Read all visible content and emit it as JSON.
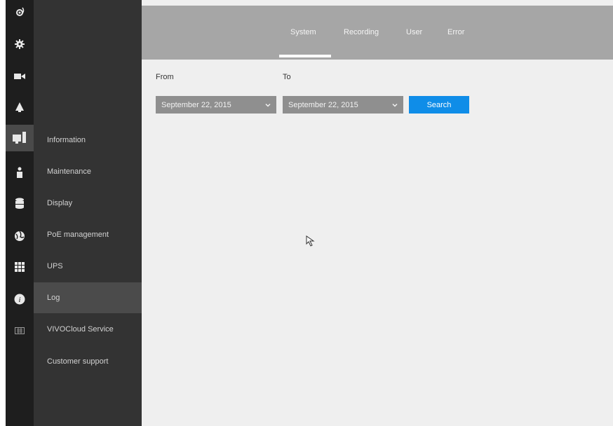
{
  "tabs": [
    {
      "label": "System"
    },
    {
      "label": "Recording"
    },
    {
      "label": "User"
    },
    {
      "label": "Error"
    }
  ],
  "active_tab": "System",
  "rail_icons": [
    "power-icon",
    "gear-icon",
    "camera-icon",
    "alarm-icon",
    "monitor-icon",
    "person-icon",
    "storage-icon",
    "network-icon",
    "grid-icon",
    "info-icon",
    "keyboard-icon"
  ],
  "active_rail_icon": "monitor-icon",
  "submenu": {
    "items": [
      {
        "label": "Information"
      },
      {
        "label": "Maintenance"
      },
      {
        "label": "Display"
      },
      {
        "label": "PoE management"
      },
      {
        "label": "UPS"
      },
      {
        "label": "Log"
      },
      {
        "label": "VIVOCloud Service"
      },
      {
        "label": "Customer support"
      }
    ],
    "active": "Log"
  },
  "filters": {
    "from_label": "From",
    "to_label": "To",
    "from_value": "September 22, 2015",
    "to_value": "September 22, 2015",
    "search_label": "Search"
  },
  "colors": {
    "accent": "#0f8de8",
    "topbar": "#a6a6a6",
    "submenu_bg": "#333333",
    "rail_bg": "#1e1e1e"
  }
}
